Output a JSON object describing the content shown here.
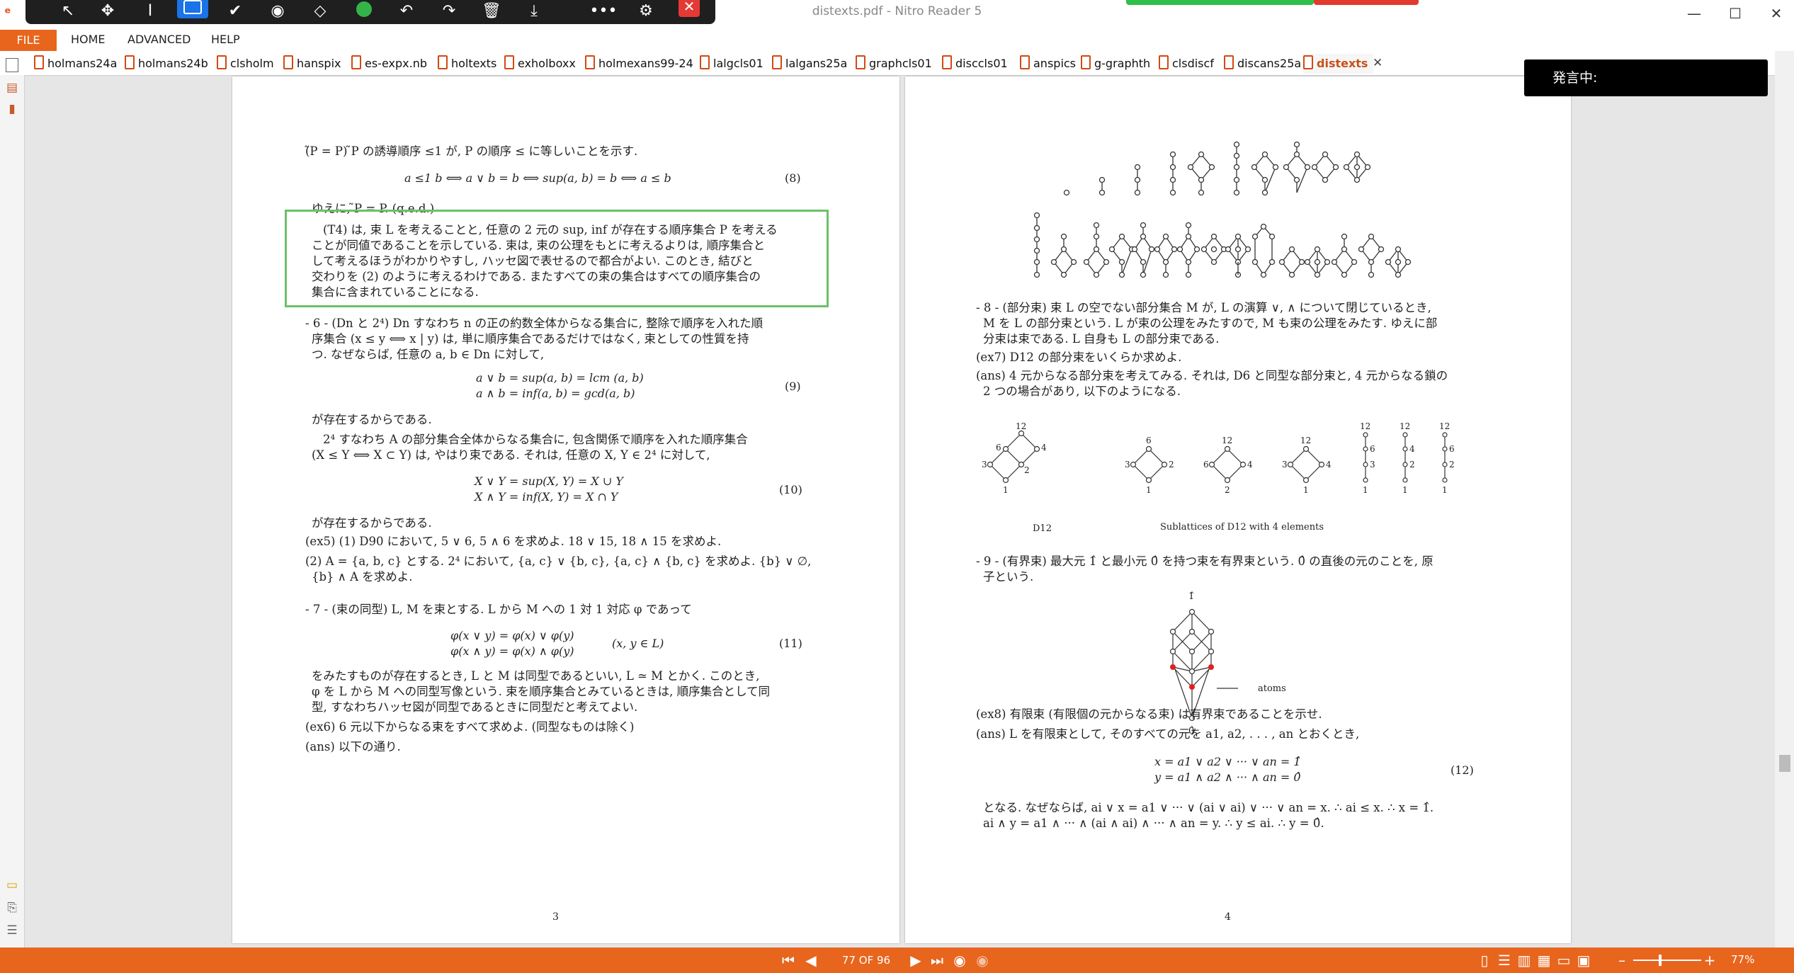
{
  "window": {
    "title": "distexts.pdf - Nitro Reader 5",
    "minimize": "—",
    "maximize": "☐",
    "close": "✕"
  },
  "floating_toolbar": {
    "icons": [
      "arrow-pointer-icon",
      "move-icon",
      "text-cursor-icon",
      "rectangle-select-icon",
      "check-icon",
      "stamp-icon",
      "eraser-icon",
      "circle-icon",
      "undo-icon",
      "redo-icon",
      "delete-icon",
      "download-icon",
      "more-icon",
      "user-settings-icon",
      "close-icon"
    ]
  },
  "ribbon": {
    "file": "FILE",
    "tabs": [
      "HOME",
      "ADVANCED",
      "HELP"
    ]
  },
  "doc_tabs": [
    "holmans24a",
    "holmans24b",
    "clsholm",
    "hanspix",
    "es-expx.nb",
    "holtexts",
    "exholboxx",
    "holmexans99-24",
    "lalgcls01",
    "lalgans25a",
    "graphcls01",
    "disccls01",
    "anspics",
    "g-graphth",
    "clsdiscf",
    "discans25a",
    "distexts"
  ],
  "doc_tab_close": "✕",
  "speaking_box": "発言中:",
  "page3": {
    "line1": "(̃P = P) ̃P の誘導順序 ≤1 が, P の順序 ≤ に等しいことを示す.",
    "eq8": "a ≤1 b ⟺ a ∨ b = b ⟺ sup(a, b) = b ⟺ a ≤ b",
    "eq8_num": "(8)",
    "qed": "ゆえに, ̃P = P.  (q.e.d.)",
    "t4": [
      "(T4) は, 束 L を考えることと, 任意の 2 元の sup, inf が存在する順序集合 P を考える",
      "ことが同値であることを示している. 束は, 束の公理をもとに考えるよりは, 順序集合と",
      "して考えるほうがわかりやすし, ハッセ図で表せるので都合がよい. このとき, 結びと",
      "交わりを (2) のように考えるわけである. またすべての束の集合はすべての順序集合の",
      "集合に含まれていることになる."
    ],
    "s6": [
      "- 6 - (Dn と 2⁴) Dn すなわち n の正の約数全体からなる集合に, 整除で順序を入れた順",
      "序集合 (x ≤ y ⟺ x | y) は, 単に順序集合であるだけではなく, 束としての性質を持",
      "つ. なぜならば, 任意の a, b ∈ Dn に対して,"
    ],
    "eq9": [
      "a ∨ b = sup(a, b) = lcm (a, b)",
      "a ∧ b = inf(a, b) = gcd(a, b)"
    ],
    "eq9_num": "(9)",
    "exists1": "が存在するからである.",
    "p24": [
      "2⁴ すなわち A の部分集合全体からなる集合に, 包含関係で順序を入れた順序集合",
      "(X ≤ Y ⟺ X ⊂ Y) は, やはり束である. それは, 任意の X, Y ∈ 2⁴ に対して,"
    ],
    "eq10": [
      "X ∨ Y = sup(X, Y) = X ∪ Y",
      "X ∧ Y = inf(X, Y) = X ∩ Y"
    ],
    "eq10_num": "(10)",
    "exists2": "が存在するからである.",
    "ex5_1": "(ex5) (1) D90 において, 5 ∨ 6, 5 ∧ 6 を求めよ. 18 ∨ 15, 18 ∧ 15 を求めよ.",
    "ex5_2": "(2) A = {a, b, c} とする. 2⁴ において, {a, c} ∨ {b, c}, {a, c} ∧ {b, c} を求めよ. {b} ∨ ∅,",
    "ex5_3": "{b} ∧ A を求めよ.",
    "s7": "- 7 - (束の同型) L, M を束とする. L から M への 1 対 1 対応 φ であって",
    "eq11": [
      "φ(x ∨ y) = φ(x) ∨ φ(y)",
      "φ(x ∧ y) = φ(x) ∧ φ(y)"
    ],
    "eq11_cond": "(x, y ∈ L)",
    "eq11_num": "(11)",
    "iso": [
      "をみたすものが存在するとき, L と M は同型であるといい, L ≃ M とかく. このとき,",
      "φ を L から M への同型写像という. 束を順序集合とみているときは, 順序集合として同",
      "型, すなわちハッセ図が同型であるときに同型だと考えてよい."
    ],
    "ex6": "(ex6) 6 元以下からなる束をすべて求めよ. (同型なものは除く)",
    "ans": "(ans) 以下の通り.",
    "page_number": "3"
  },
  "page4": {
    "s8": [
      "- 8 - (部分束) 束 L の空でない部分集合 M が, L の演算 ∨, ∧ について閉じているとき,",
      "M を L の部分束という. L が束の公理をみたすので, M も束の公理をみたす. ゆえに部",
      "分束は束である. L 自身も L の部分束である."
    ],
    "ex7": "(ex7) D12 の部分束をいくらか求めよ.",
    "ans7": [
      "(ans) 4 元からなる部分束を考えてみる. それは, D6 と同型な部分束と, 4 元からなる鎖の",
      "2 つの場合があり, 以下のようになる."
    ],
    "d12_caption": "D12",
    "sublattices_caption": "Sublattices of D12 with 4 elements",
    "s9": [
      "- 9 - (有界束) 最大元 1̂ と最小元 0̂ を持つ束を有界束という. 0̂ の直後の元のことを, 原",
      "子という."
    ],
    "top_label": "1̂",
    "bottom_label": "0̂",
    "atoms_label": "atoms",
    "ex8": "(ex8) 有限束 (有限個の元からなる束) は有界束であることを示せ.",
    "ans8": "(ans) L を有限束として, そのすべての元を a1, a2, . . . , an とおくとき,",
    "eq12": [
      "x = a1 ∨ a2 ∨ ··· ∨ an = 1̂",
      "y = a1 ∧ a2 ∧ ··· ∧ an = 0̂"
    ],
    "eq12_num": "(12)",
    "concl": [
      "となる. なぜならば, ai ∨ x = a1 ∨ ··· ∨ (ai ∨ ai) ∨ ··· ∨ an = x. ∴ ai ≤ x. ∴ x = 1̂.",
      "ai ∧ y = a1 ∧ ··· ∧ (ai ∧ ai) ∧ ··· ∧ an = y. ∴ y ≤ ai. ∴ y = 0̂."
    ],
    "page_number": "4",
    "d12_nodes": [
      "12",
      "6",
      "4",
      "3",
      "2",
      "1"
    ],
    "sub1": [
      "6",
      "3",
      "2",
      "1"
    ],
    "sub2": [
      "12",
      "6",
      "4",
      "2"
    ],
    "sub3": [
      "12",
      "3",
      "4",
      "1"
    ],
    "chains": [
      [
        "12",
        "6",
        "3",
        "1"
      ],
      [
        "12",
        "4",
        "2",
        "1"
      ],
      [
        "12",
        "6",
        "2",
        "1"
      ]
    ]
  },
  "status": {
    "page_indicator": "77 OF 96",
    "zoom": "77%",
    "zoom_minus": "–",
    "zoom_plus": "+"
  },
  "colors": {
    "accent": "#e8651d",
    "highlight_box": "#6cc06a",
    "atom_dots": "#e02020"
  }
}
